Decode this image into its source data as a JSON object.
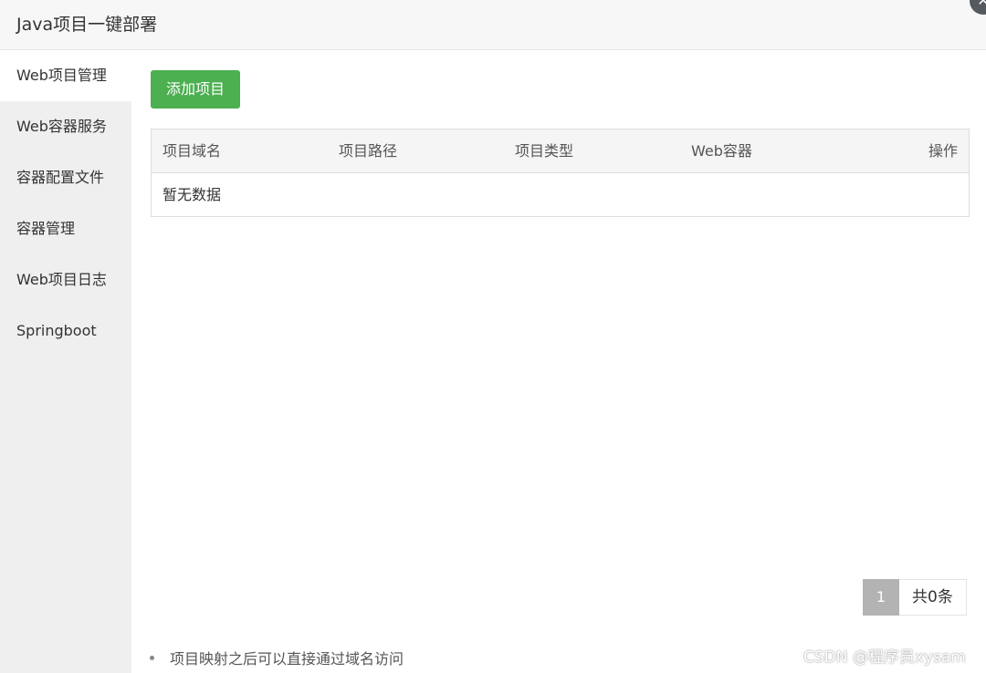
{
  "window": {
    "title": "Java项目一键部署",
    "close_glyph": "✕"
  },
  "sidebar": {
    "items": [
      {
        "label": "Web项目管理",
        "active": true
      },
      {
        "label": "Web容器服务",
        "active": false
      },
      {
        "label": "容器配置文件",
        "active": false
      },
      {
        "label": "容器管理",
        "active": false
      },
      {
        "label": "Web项目日志",
        "active": false
      },
      {
        "label": "Springboot",
        "active": false
      }
    ]
  },
  "toolbar": {
    "add_label": "添加项目"
  },
  "table": {
    "columns": [
      "项目域名",
      "项目路径",
      "项目类型",
      "Web容器",
      "操作"
    ],
    "rows": [],
    "empty_text": "暂无数据"
  },
  "pagination": {
    "current_page": "1",
    "total_text": "共0条"
  },
  "tips": [
    "项目映射之后可以直接通过域名访问"
  ],
  "watermark": "CSDN @程序员xysam",
  "colors": {
    "primary_button": "#4caf50",
    "sidebar_bg": "#efefef",
    "active_page": "#b3b3b3"
  }
}
